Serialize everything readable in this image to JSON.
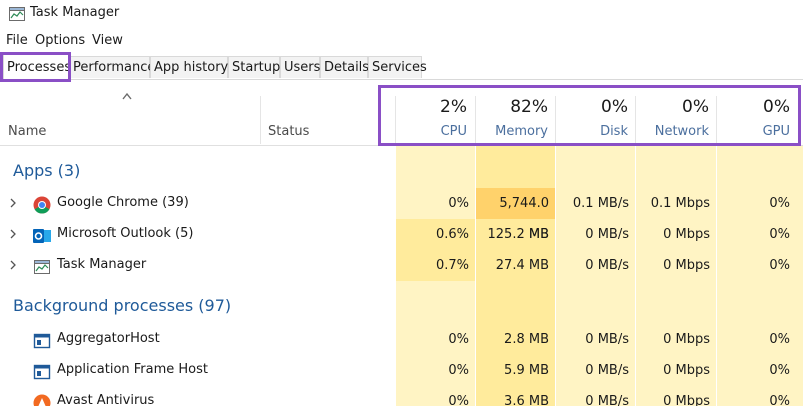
{
  "window": {
    "title": "Task Manager"
  },
  "menu": {
    "file": "File",
    "options": "Options",
    "view": "View"
  },
  "tabs": [
    {
      "label": "Processes",
      "active": true
    },
    {
      "label": "Performance"
    },
    {
      "label": "App history"
    },
    {
      "label": "Startup"
    },
    {
      "label": "Users"
    },
    {
      "label": "Details"
    },
    {
      "label": "Services"
    }
  ],
  "header": {
    "name": "Name",
    "status": "Status",
    "cpu": {
      "pct": "2%",
      "label": "CPU"
    },
    "memory": {
      "pct": "82%",
      "label": "Memory"
    },
    "disk": {
      "pct": "0%",
      "label": "Disk"
    },
    "network": {
      "pct": "0%",
      "label": "Network"
    },
    "gpu": {
      "pct": "0%",
      "label": "GPU"
    }
  },
  "groups": {
    "apps": "Apps (3)",
    "background": "Background processes (97)"
  },
  "apps": [
    {
      "name": "Google Chrome (39)",
      "icon": "chrome-icon",
      "cpu": "0%",
      "memory": "5,744.0 MB",
      "disk": "0.1 MB/s",
      "network": "0.1 Mbps",
      "gpu": "0%"
    },
    {
      "name": "Microsoft Outlook (5)",
      "icon": "outlook-icon",
      "cpu": "0.6%",
      "memory": "125.2 MB",
      "disk": "0 MB/s",
      "network": "0 Mbps",
      "gpu": "0%"
    },
    {
      "name": "Task Manager",
      "icon": "task-manager-icon",
      "cpu": "0.7%",
      "memory": "27.4 MB",
      "disk": "0 MB/s",
      "network": "0 Mbps",
      "gpu": "0%"
    }
  ],
  "background": [
    {
      "name": "AggregatorHost",
      "icon": "window-icon",
      "cpu": "0%",
      "memory": "2.8 MB",
      "disk": "0 MB/s",
      "network": "0 Mbps",
      "gpu": "0%"
    },
    {
      "name": "Application Frame Host",
      "icon": "window-icon",
      "cpu": "0%",
      "memory": "5.9 MB",
      "disk": "0 MB/s",
      "network": "0 Mbps",
      "gpu": "0%"
    },
    {
      "name": "Avast Antivirus",
      "icon": "avast-icon",
      "cpu": "0%",
      "memory": "3.6 MB",
      "disk": "0 MB/s",
      "network": "0 Mbps",
      "gpu": "0%"
    }
  ],
  "colors": {
    "highlight": "#8a4fc6",
    "heat_light": "#fff4c4",
    "heat_medium": "#ffeb9c",
    "heat_strong": "#ffd26b",
    "group_text": "#1f5a99"
  }
}
